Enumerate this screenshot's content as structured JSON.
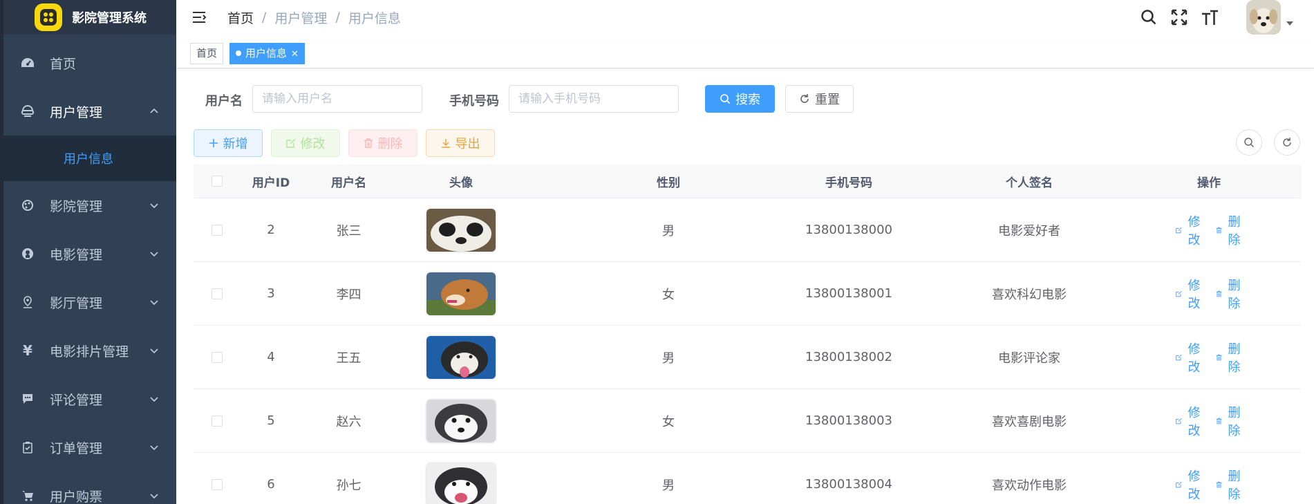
{
  "app": {
    "title": "影院管理系统"
  },
  "sidebar": {
    "items": [
      {
        "label": "首页",
        "icon": "dashboard-icon"
      },
      {
        "label": "用户管理",
        "icon": "user-icon",
        "open": true,
        "children": [
          {
            "label": "用户信息"
          }
        ]
      },
      {
        "label": "影院管理",
        "icon": "cinema-icon"
      },
      {
        "label": "电影管理",
        "icon": "github-icon"
      },
      {
        "label": "影厅管理",
        "icon": "location-icon"
      },
      {
        "label": "电影排片管理",
        "icon": "yen-icon"
      },
      {
        "label": "评论管理",
        "icon": "message-icon"
      },
      {
        "label": "订单管理",
        "icon": "clipboard-icon"
      },
      {
        "label": "用户购票",
        "icon": "cart-icon"
      }
    ]
  },
  "breadcrumb": {
    "home": "首页",
    "level1": "用户管理",
    "level2": "用户信息"
  },
  "tags": {
    "home": "首页",
    "active": "用户信息"
  },
  "search": {
    "username_label": "用户名",
    "username_placeholder": "请输入用户名",
    "phone_label": "手机号码",
    "phone_placeholder": "请输入手机号码",
    "search_button": "搜索",
    "reset_button": "重置"
  },
  "toolbar": {
    "add": "新增",
    "edit": "修改",
    "delete": "删除",
    "export": "导出"
  },
  "table": {
    "headers": {
      "id": "用户ID",
      "name": "用户名",
      "avatar": "头像",
      "gender": "性别",
      "phone": "手机号码",
      "sign": "个人签名",
      "ops": "操作"
    },
    "rows": [
      {
        "id": "2",
        "name": "张三",
        "gender": "男",
        "phone": "13800138000",
        "sign": "电影爱好者",
        "edit": "修改",
        "delete": "删除"
      },
      {
        "id": "3",
        "name": "李四",
        "gender": "女",
        "phone": "13800138001",
        "sign": "喜欢科幻电影",
        "edit": "修改",
        "delete": "删除"
      },
      {
        "id": "4",
        "name": "王五",
        "gender": "男",
        "phone": "13800138002",
        "sign": "电影评论家",
        "edit": "修改",
        "delete": "删除"
      },
      {
        "id": "5",
        "name": "赵六",
        "gender": "女",
        "phone": "13800138003",
        "sign": "喜欢喜剧电影",
        "edit": "修改",
        "delete": "删除"
      },
      {
        "id": "6",
        "name": "孙七",
        "gender": "男",
        "phone": "13800138004",
        "sign": "喜欢动作电影",
        "edit": "修改",
        "delete": "删除"
      }
    ]
  },
  "colors": {
    "primary": "#409eff",
    "sidebar_bg": "#304156",
    "logo_yellow": "#f5d90a"
  }
}
